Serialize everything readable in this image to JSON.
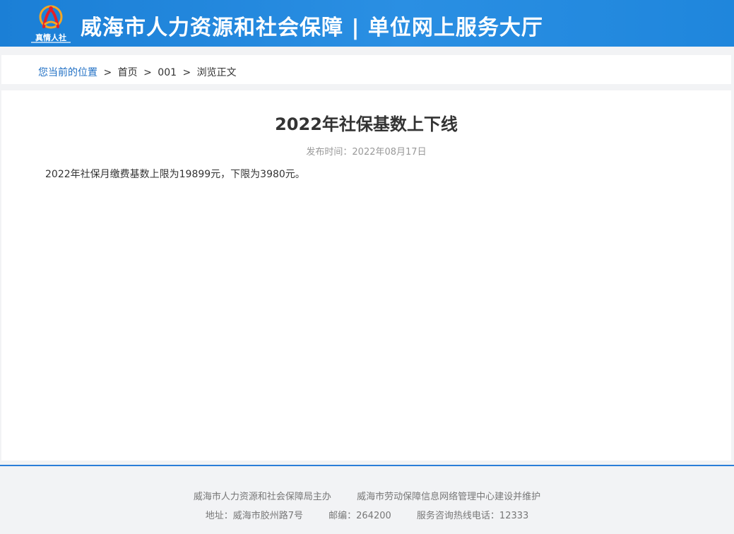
{
  "header": {
    "logo_text": "真情人社",
    "title": "威海市人力资源和社会保障 | 单位网上服务大厅"
  },
  "breadcrumb": {
    "label": "您当前的位置",
    "sep": ">",
    "items": [
      "首页",
      "001",
      "浏览正文"
    ]
  },
  "article": {
    "title": "2022年社保基数上下线",
    "publish_time": "发布时间：2022年08月17日",
    "body": "2022年社保月缴费基数上限为19899元，下限为3980元。"
  },
  "footer": {
    "line1": [
      "威海市人力资源和社会保障局主办",
      "威海市劳动保障信息网络管理中心建设并维护"
    ],
    "line2": [
      "地址：威海市胶州路7号",
      "邮编：264200",
      "服务咨询热线电话：12333"
    ]
  },
  "colors": {
    "header_blue": "#1b7fd6",
    "breadcrumb_label": "#1f6fc4",
    "footer_border": "#2a7ed8"
  }
}
